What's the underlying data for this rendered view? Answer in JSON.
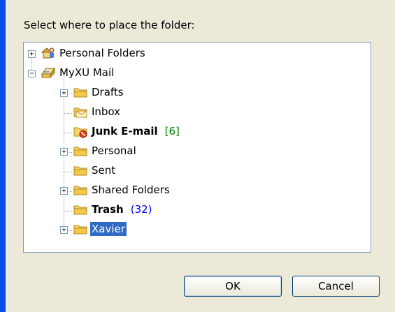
{
  "prompt": "Select where to place the folder:",
  "tree": [
    {
      "label": "Personal Folders",
      "icon": "personal-folders-icon",
      "expander": "+"
    },
    {
      "label": "MyXU Mail",
      "icon": "mailbox-icon",
      "expander": "−"
    },
    {
      "label": "Drafts",
      "icon": "folder-icon",
      "expander": "+"
    },
    {
      "label": "Inbox",
      "icon": "inbox-icon"
    },
    {
      "label": "Junk E-mail",
      "icon": "junk-folder-icon",
      "bold": true,
      "count": "[6]"
    },
    {
      "label": "Personal",
      "icon": "folder-icon",
      "expander": "+"
    },
    {
      "label": "Sent",
      "icon": "folder-icon"
    },
    {
      "label": "Shared Folders",
      "icon": "folder-icon",
      "expander": "+"
    },
    {
      "label": "Trash",
      "icon": "folder-icon",
      "bold": true,
      "count": "(32)"
    },
    {
      "label": "Xavier",
      "icon": "folder-icon",
      "expander": "+",
      "selected": true
    }
  ],
  "buttons": {
    "ok": "OK",
    "cancel": "Cancel"
  },
  "colors": {
    "selection": "#316ac5",
    "junk_count": "#008000",
    "trash_count": "#0000ff",
    "window_border": "#0a4ce6"
  }
}
